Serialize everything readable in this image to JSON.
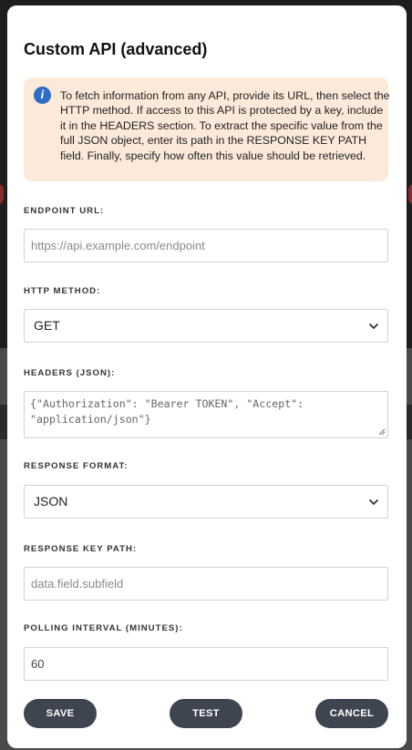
{
  "modal": {
    "title": "Custom API (advanced)",
    "info_icon": "info-icon",
    "info_text": "To fetch information from any API, provide its URL, then select the HTTP method. If access to this API is protected by a key, include it in the HEADERS section. To extract the specific value from the full JSON object, enter its path in the RESPONSE KEY PATH field. Finally, specify how often this value should be retrieved."
  },
  "fields": {
    "endpoint": {
      "label": "ENDPOINT URL:",
      "placeholder": "https://api.example.com/endpoint"
    },
    "method": {
      "label": "HTTP METHOD:",
      "value": "GET"
    },
    "headers": {
      "label": "HEADERS (JSON):",
      "placeholder": "{\"Authorization\": \"Bearer TOKEN\", \"Accept\": \"application/json\"}"
    },
    "format": {
      "label": "RESPONSE FORMAT:",
      "value": "JSON"
    },
    "key_path": {
      "label": "RESPONSE KEY PATH:",
      "placeholder": "data.field.subfield"
    },
    "interval": {
      "label": "POLLING INTERVAL (MINUTES):",
      "value": "60"
    }
  },
  "buttons": {
    "save": "SAVE",
    "test": "TEST",
    "cancel": "CANCEL"
  },
  "colors": {
    "info_bg": "#fbe9d9",
    "info_icon": "#2f6cc3",
    "button_bg": "#3f4550"
  }
}
